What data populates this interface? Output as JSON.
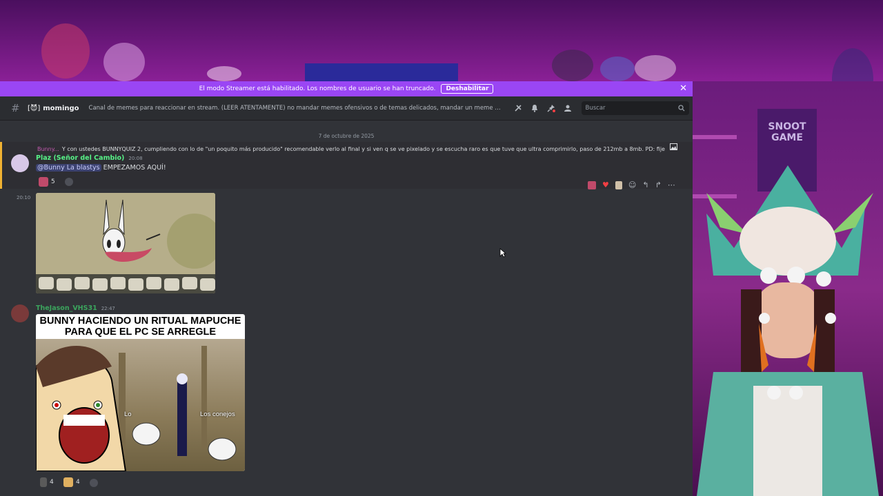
{
  "banner": {
    "text": "El modo Streamer está habilitado. Los nombres de usuario se han truncado.",
    "button": "Deshabilitar",
    "close": "✕"
  },
  "header": {
    "hash": "#",
    "channel_emoji": "[😈]",
    "channel_name": "momingo",
    "topic": "Canal de memes para reaccionar en stream. (LEER ATENTAMENTE) no mandar memes ofensivos o de temas delicados, mandar un meme a la vez , ver qu...",
    "search_placeholder": "Buscar"
  },
  "date_divider": "7 de octubre de 2025",
  "message1": {
    "reply_name": "Bunny...",
    "reply_text": "Y con ustedes BUNNYQUIZ 2, cumpliendo con lo de \"un poquito más producido\" recomendable verlo al final y si ven q se ve pixelado y se escucha raro es que tuve que ultra comprimirlo, paso de 212mb a 8mb. PD: fijense en l...",
    "username": "Plaz (Señor del Cambio)",
    "time": "20:08",
    "mention": "@Bunny La blastys",
    "text": " EMPEZAMOS AQUÍ!",
    "reaction_count": "5"
  },
  "message2": {
    "left_time": "20:10"
  },
  "message3": {
    "username": "TheJason_VHS31",
    "time": "22:47",
    "meme_caption": "BUNNY HACIENDO UN RITUAL MAPUCHE PARA QUE EL PC SE ARREGLE",
    "label_left": "Lo",
    "label_right": "Los conejos",
    "reaction1_count": "4",
    "reaction2_count": "4"
  },
  "stream": {
    "poster_text": "SNOOT GAME"
  },
  "colors": {
    "banner": "#9a46f4",
    "username1": "#57f287",
    "username2": "#3ba55d",
    "highlight_border": "#f0b232"
  }
}
